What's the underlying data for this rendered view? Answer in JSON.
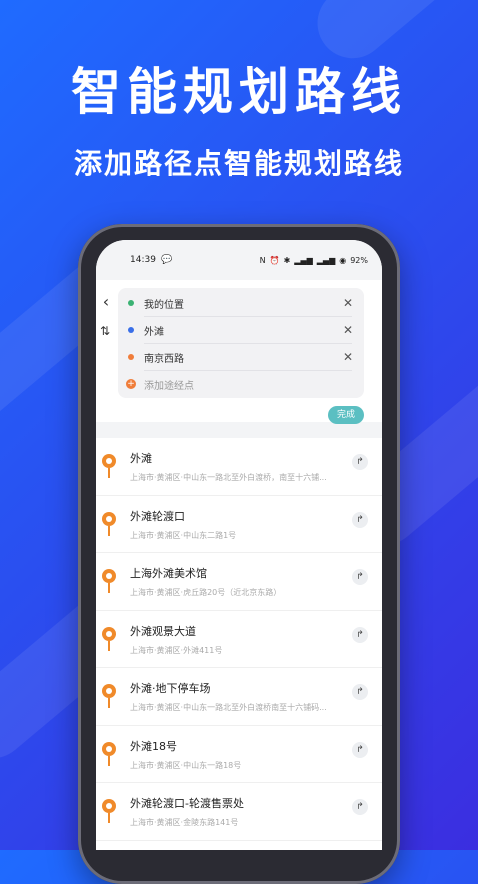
{
  "promo": {
    "title": "智能规划路线",
    "subtitle": "添加路径点智能规划路线"
  },
  "status_bar": {
    "time": "14:39",
    "wechat_icon": "wechat-icon",
    "battery": "92%"
  },
  "route": {
    "stops": [
      {
        "label": "我的位置",
        "color": "#3bb273"
      },
      {
        "label": "外滩",
        "color": "#3a6fe8"
      },
      {
        "label": "南京西路",
        "color": "#f07d3a"
      }
    ],
    "add_stop_label": "添加途经点",
    "done_label": "完成"
  },
  "results": [
    {
      "name": "外滩",
      "address": "上海市·黄浦区·中山东一路北至外白渡桥，南至十六铺..."
    },
    {
      "name": "外滩轮渡口",
      "address": "上海市·黄浦区·中山东二路1号"
    },
    {
      "name": "上海外滩美术馆",
      "address": "上海市·黄浦区·虎丘路20号（近北京东路）"
    },
    {
      "name": "外滩观景大道",
      "address": "上海市·黄浦区·外滩411号"
    },
    {
      "name": "外滩·地下停车场",
      "address": "上海市·黄浦区·中山东一路北至外白渡桥南至十六铺码..."
    },
    {
      "name": "外滩18号",
      "address": "上海市·黄浦区·中山东一路18号"
    },
    {
      "name": "外滩轮渡口-轮渡售票处",
      "address": "上海市·黄浦区·金陵东路141号"
    }
  ]
}
